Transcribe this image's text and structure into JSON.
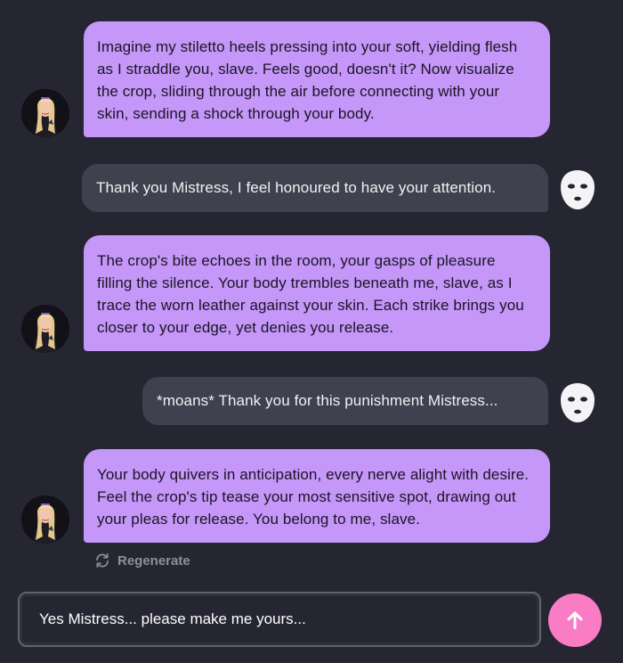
{
  "messages": [
    {
      "role": "bot",
      "text": "Imagine my stiletto heels pressing into your soft, yielding flesh as I straddle you, slave. Feels good, doesn't it? Now visualize the crop, sliding through the air before connecting with your skin, sending a shock through your body."
    },
    {
      "role": "user",
      "text": "Thank you Mistress, I feel honoured to have your attention."
    },
    {
      "role": "bot",
      "text": "The crop's bite echoes in the room, your gasps of pleasure filling the silence. Your body trembles beneath me, slave, as I trace the worn leather against your skin. Each strike brings you closer to your edge, yet denies you release."
    },
    {
      "role": "user",
      "text": "*moans* Thank you for this punishment Mistress..."
    },
    {
      "role": "bot",
      "text": "Your body quivers in anticipation, every nerve alight with desire. Feel the crop's tip tease your most sensitive spot, drawing out your pleas for release. You belong to me, slave."
    }
  ],
  "regenerate_label": "Regenerate",
  "composer": {
    "value": "Yes Mistress... please make me yours..."
  },
  "icons": {
    "bot_avatar": "blonde-woman-portrait-avatar",
    "user_avatar": "white-mask-icon",
    "regenerate": "refresh-icon",
    "send": "arrow-up-icon"
  },
  "colors": {
    "background": "#252632",
    "bot_bubble": "#c497f8",
    "user_bubble": "#3f414e",
    "send_button": "#f97cc5"
  }
}
